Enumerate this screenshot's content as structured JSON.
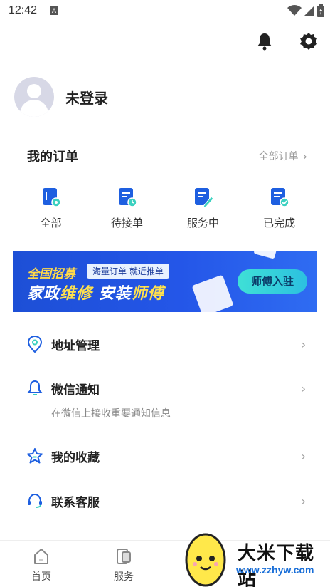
{
  "status_bar": {
    "time": "12:42",
    "notification_icon": "A"
  },
  "top_icons": [
    "bell-icon",
    "gear-icon"
  ],
  "profile": {
    "name": "未登录"
  },
  "orders": {
    "title": "我的订单",
    "all_label": "全部订单",
    "items": [
      {
        "label": "全部",
        "icon": "order-all-icon"
      },
      {
        "label": "待接单",
        "icon": "order-pending-icon"
      },
      {
        "label": "服务中",
        "icon": "order-in-service-icon"
      },
      {
        "label": "已完成",
        "icon": "order-completed-icon"
      }
    ]
  },
  "banner": {
    "tag": "全国招募",
    "subtag": "海量订单 就近推单",
    "headline_part1": "家政",
    "headline_part2": "维修",
    "headline_part3": " 安装",
    "headline_part4": "师傅",
    "button": "师傅入驻"
  },
  "menu": [
    {
      "label": "地址管理",
      "icon": "location-pin-icon"
    },
    {
      "label": "微信通知",
      "icon": "bell-outline-icon",
      "sub": "在微信上接收重要通知信息"
    },
    {
      "label": "我的收藏",
      "icon": "star-icon"
    },
    {
      "label": "联系客服",
      "icon": "headset-icon"
    }
  ],
  "tabbar": [
    {
      "label": "首页",
      "icon": "home-icon"
    },
    {
      "label": "服务",
      "icon": "service-icon"
    }
  ],
  "watermark": {
    "title": "大米下载站",
    "url": "www.zzhyw.com"
  },
  "colors": {
    "accent": "#1e5fe0",
    "banner_bg": "#2456e8",
    "banner_yellow": "#ffd94a",
    "button_teal": "#3fe0d6"
  }
}
